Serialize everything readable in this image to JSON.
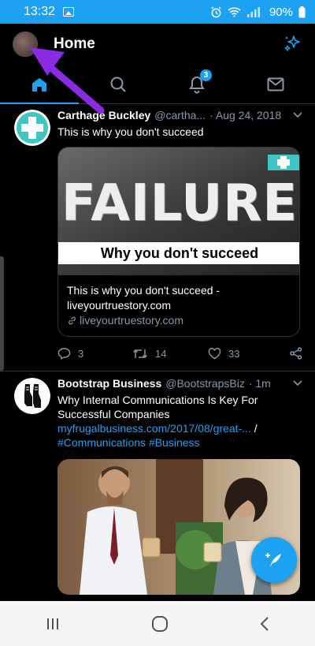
{
  "status_bar": {
    "time": "13:32",
    "battery": "90%"
  },
  "header": {
    "title": "Home"
  },
  "tabs": {
    "notifications_badge": "3"
  },
  "tweets": [
    {
      "name": "Carthage Buckley",
      "handle": "@cartha...",
      "date": "· Aug 24, 2018",
      "text": "This is why you don't succeed",
      "card": {
        "image_headline": "FAILURE",
        "image_caption": "Why you don't succeed",
        "title_line1": "This is why you don't succeed -",
        "title_line2": "liveyourtruestory.com",
        "domain": "liveyourtruestory.com"
      },
      "counts": {
        "replies": "3",
        "retweets": "14",
        "likes": "33"
      }
    },
    {
      "name": "Bootstrap Business",
      "handle": "@BootstrapsBiz",
      "date": "· 1m",
      "text_line1": "Why Internal Communications Is Key For",
      "text_line2": "Successful Companies",
      "link": "myfrugalbusiness.com/2017/08/great-...",
      "link_suffix": " /",
      "hashtags": "#Communications #Business"
    }
  ],
  "colors": {
    "accent": "#1da1f2",
    "annotation_arrow": "#8a2be2"
  }
}
